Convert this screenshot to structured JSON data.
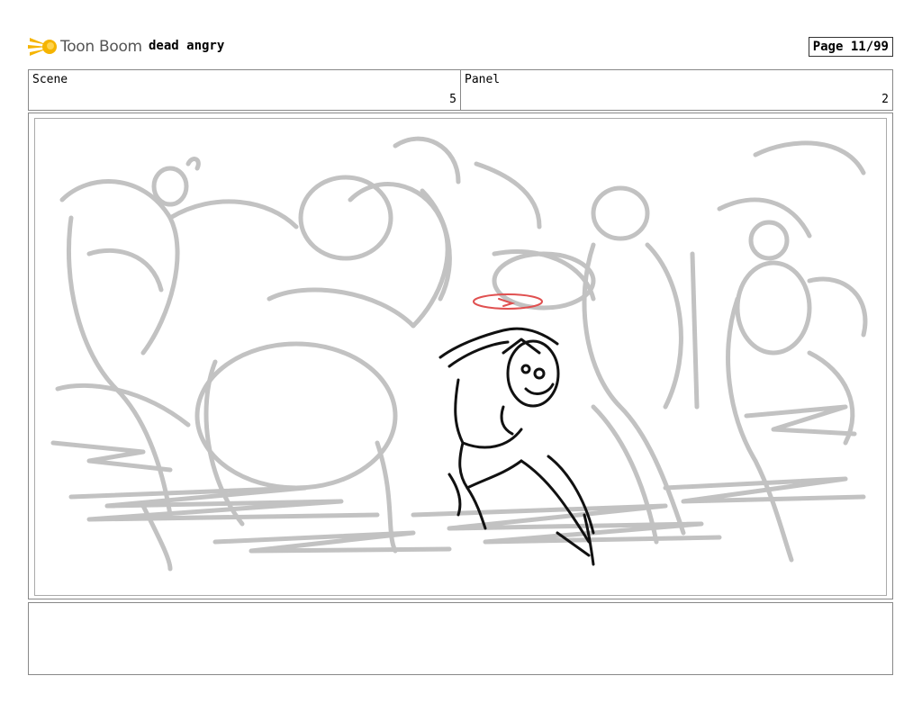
{
  "header": {
    "logo_text": "Toon Boom",
    "project_title": "dead angry",
    "page_label": "Page 11/99"
  },
  "info": {
    "scene_label": "Scene",
    "scene_value": "5",
    "panel_label": "Panel",
    "panel_value": "2"
  },
  "panel": {
    "artwork": "sketch-illustration-icon"
  },
  "notes": {
    "text": ""
  },
  "colors": {
    "logo_yellow": "#f5b400",
    "sketch_grey": "#c2c2c2",
    "ink_black": "#111111",
    "accent_red": "#e05050"
  }
}
